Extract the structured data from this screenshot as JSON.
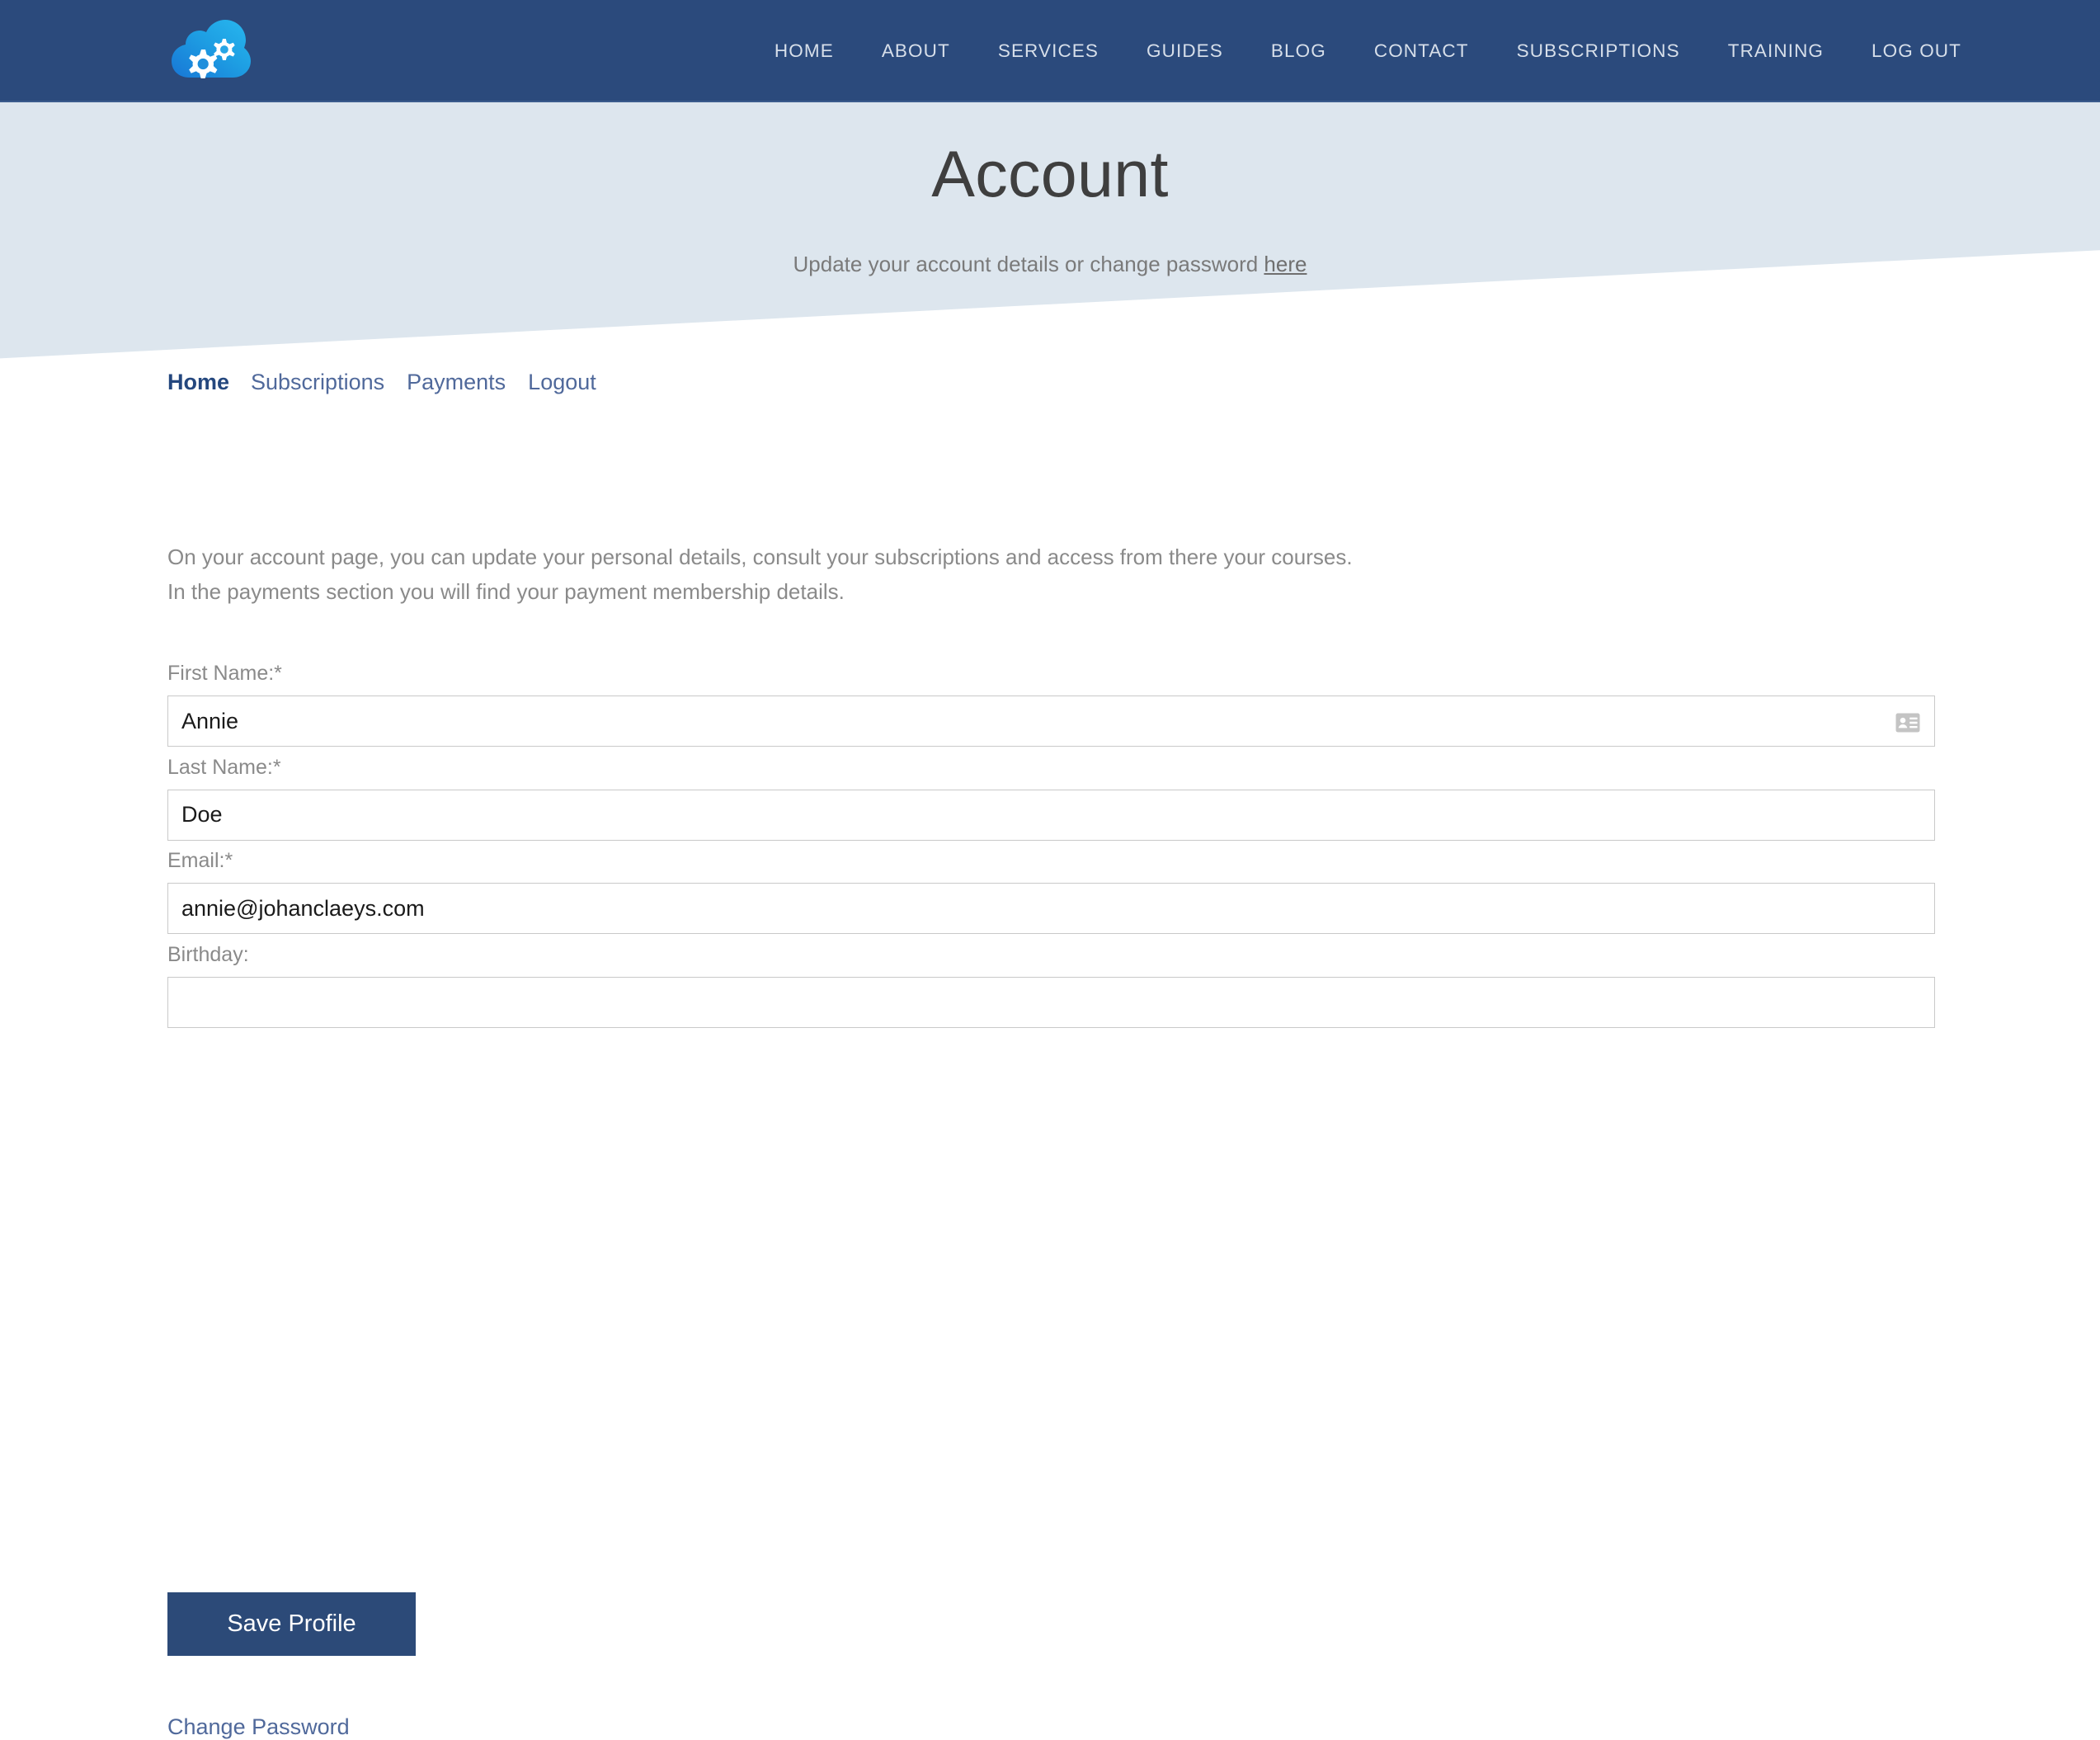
{
  "header": {
    "logo_icon": "cloud-gears-logo",
    "nav": [
      {
        "label": "HOME"
      },
      {
        "label": "ABOUT"
      },
      {
        "label": "SERVICES"
      },
      {
        "label": "GUIDES"
      },
      {
        "label": "BLOG"
      },
      {
        "label": "CONTACT"
      },
      {
        "label": "SUBSCRIPTIONS"
      },
      {
        "label": "TRAINING"
      },
      {
        "label": "LOG OUT"
      }
    ],
    "background_color": "#2b4a7c"
  },
  "hero": {
    "title": "Account",
    "subtitle_prefix": "Update your account details or change password ",
    "subtitle_link": "here",
    "background_color": "#dde6ee"
  },
  "subnav": {
    "items": [
      {
        "label": "Home",
        "active": true
      },
      {
        "label": "Subscriptions",
        "active": false
      },
      {
        "label": "Payments",
        "active": false
      },
      {
        "label": "Logout",
        "active": false
      }
    ]
  },
  "intro": {
    "line1": "On your account page, you can update your personal details, consult your subscriptions and access from there your courses.",
    "line2": "In the payments section you will find your payment membership details."
  },
  "form": {
    "fields": [
      {
        "label": "First Name:*",
        "value": "Annie",
        "placeholder": "",
        "icon": "contact-card-icon"
      },
      {
        "label": "Last Name:*",
        "value": "Doe",
        "placeholder": "",
        "icon": ""
      },
      {
        "label": "Email:*",
        "value": "annie@johanclaeys.com",
        "placeholder": "",
        "icon": ""
      },
      {
        "label": "Birthday:",
        "value": "",
        "placeholder": "",
        "icon": ""
      }
    ],
    "save_label": "Save Profile",
    "change_password_label": "Change Password",
    "button_color": "#2c4a78",
    "link_color": "#50699b"
  }
}
